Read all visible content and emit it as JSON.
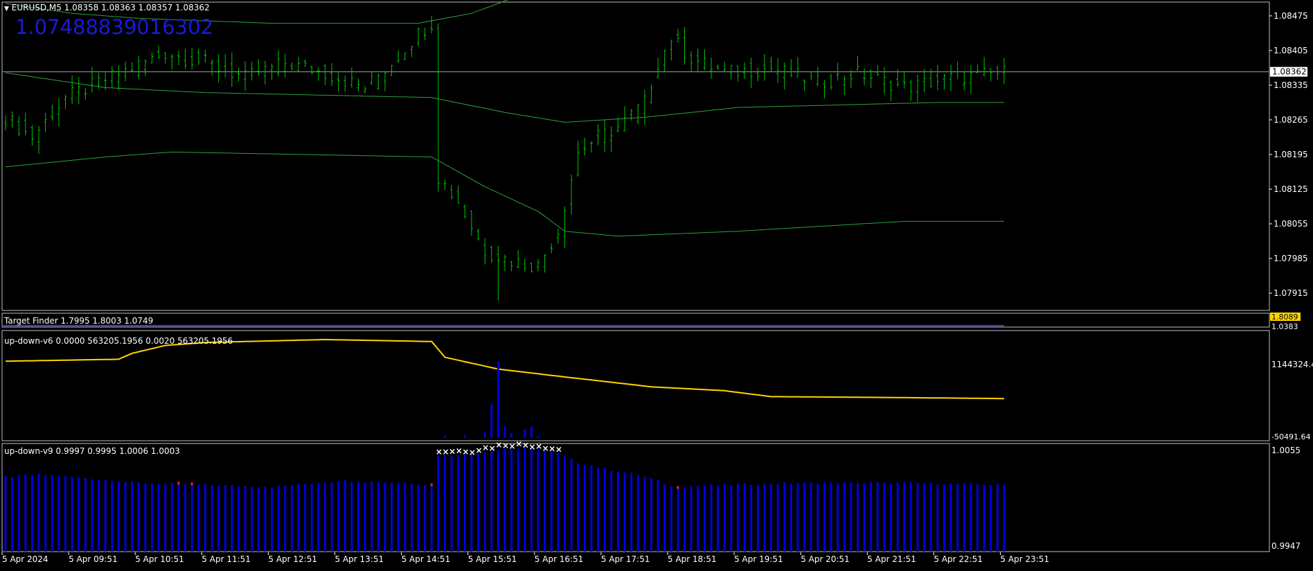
{
  "colors": {
    "background": "#000000",
    "frame": "#c0c0c0",
    "candle": "#00c800",
    "envelope": "#2ea043",
    "bid_line": "#a0a0a0",
    "price_tag_bg": "#ffffff",
    "big_value": "#1a1adb",
    "yellow_line": "#ffd700",
    "yellow_tag": "#ffd700",
    "histogram_blue": "#0000e0",
    "histogram_red": "#ff2020",
    "marker_white": "#ffffff",
    "target_line": "#3b3bd8"
  },
  "main_panel": {
    "header": "EURUSD,M5  1.08358 1.08363 1.08357 1.08362",
    "big_value": "1.07488839016302",
    "current_price_tag": "1.08362",
    "price_axis": [
      "1.08475",
      "1.08405",
      "1.08335",
      "1.08265",
      "1.08195",
      "1.08125",
      "1.08055",
      "1.07985",
      "1.07915"
    ]
  },
  "target_panel": {
    "header": "Target Finder 1.7995 1.8003 1.0749",
    "tag_yellow": "1.8089",
    "tag_white": "1.0383"
  },
  "updown6_panel": {
    "header": "up-down-v6 0.0000 563205.1956 0.0020 563205.1956",
    "axis_top": "1144324.4",
    "axis_bottom": "-50491.64"
  },
  "updown9_panel": {
    "header": "up-down-v9 0.9997 0.9995 1.0006 1.0003",
    "axis_top": "1.0055",
    "axis_bottom": "0.9947"
  },
  "time_axis": [
    "5 Apr 2024",
    "5 Apr 09:51",
    "5 Apr 10:51",
    "5 Apr 11:51",
    "5 Apr 12:51",
    "5 Apr 13:51",
    "5 Apr 14:51",
    "5 Apr 15:51",
    "5 Apr 16:51",
    "5 Apr 17:51",
    "5 Apr 18:51",
    "5 Apr 19:51",
    "5 Apr 20:51",
    "5 Apr 21:51",
    "5 Apr 22:51",
    "5 Apr 23:51"
  ],
  "chart_data": {
    "type": "candlestick",
    "symbol": "EURUSD",
    "timeframe": "M5",
    "price_ylim": [
      1.0788,
      1.085
    ],
    "close_anchors": [
      [
        0,
        1.0827
      ],
      [
        4,
        1.0823
      ],
      [
        9,
        1.0831
      ],
      [
        14,
        1.0834
      ],
      [
        19,
        1.0837
      ],
      [
        24,
        1.084
      ],
      [
        30,
        1.0838
      ],
      [
        36,
        1.0835
      ],
      [
        42,
        1.0838
      ],
      [
        48,
        1.0836
      ],
      [
        54,
        1.0833
      ],
      [
        58,
        1.0838
      ],
      [
        62,
        1.0844
      ],
      [
        64,
        1.0846
      ],
      [
        65,
        1.0815
      ],
      [
        68,
        1.081
      ],
      [
        72,
        1.08
      ],
      [
        76,
        1.0798
      ],
      [
        80,
        1.0797
      ],
      [
        83,
        1.0804
      ],
      [
        86,
        1.082
      ],
      [
        89,
        1.0823
      ],
      [
        92,
        1.0825
      ],
      [
        96,
        1.083
      ],
      [
        98,
        1.0838
      ],
      [
        100,
        1.0843
      ],
      [
        103,
        1.0839
      ],
      [
        108,
        1.0836
      ],
      [
        115,
        1.0837
      ],
      [
        122,
        1.0834
      ],
      [
        128,
        1.0836
      ],
      [
        135,
        1.0833
      ],
      [
        142,
        1.0835
      ],
      [
        150,
        1.0836
      ]
    ],
    "envelope_upper": [
      [
        0,
        1.085
      ],
      [
        10,
        1.0848
      ],
      [
        20,
        1.0847
      ],
      [
        40,
        1.0846
      ],
      [
        62,
        1.0846
      ],
      [
        70,
        1.0848
      ],
      [
        76,
        1.0851
      ]
    ],
    "envelope_middle": [
      [
        0,
        1.0836
      ],
      [
        15,
        1.0833
      ],
      [
        30,
        1.0832
      ],
      [
        64,
        1.0831
      ],
      [
        75,
        1.0828
      ],
      [
        84,
        1.0826
      ],
      [
        96,
        1.0827
      ],
      [
        110,
        1.0829
      ],
      [
        140,
        1.083
      ],
      [
        150,
        1.083
      ]
    ],
    "envelope_lower": [
      [
        0,
        1.0817
      ],
      [
        15,
        1.0819
      ],
      [
        25,
        1.082
      ],
      [
        64,
        1.0819
      ],
      [
        72,
        1.0813
      ],
      [
        80,
        1.0808
      ],
      [
        84,
        1.0804
      ],
      [
        92,
        1.0803
      ],
      [
        110,
        1.0804
      ],
      [
        135,
        1.0806
      ],
      [
        150,
        1.0806
      ]
    ],
    "yellow_line": [
      [
        0,
        0.78
      ],
      [
        17,
        0.8
      ],
      [
        19,
        0.86
      ],
      [
        24,
        0.94
      ],
      [
        30,
        0.97
      ],
      [
        48,
        1.0
      ],
      [
        64,
        0.98
      ],
      [
        66,
        0.82
      ],
      [
        74,
        0.7
      ],
      [
        84,
        0.62
      ],
      [
        97,
        0.52
      ],
      [
        108,
        0.48
      ],
      [
        115,
        0.42
      ],
      [
        135,
        0.41
      ],
      [
        150,
        0.4
      ]
    ],
    "updown6_spikes": [
      [
        66,
        0.02
      ],
      [
        69,
        0.03
      ],
      [
        72,
        0.06
      ],
      [
        73,
        0.35
      ],
      [
        74,
        0.78
      ],
      [
        75,
        0.12
      ],
      [
        76,
        0.05
      ],
      [
        78,
        0.09
      ],
      [
        79,
        0.12
      ],
      [
        80,
        0.02
      ]
    ],
    "updown9_levels": [
      [
        0,
        0.74
      ],
      [
        5,
        0.76
      ],
      [
        10,
        0.74
      ],
      [
        20,
        0.68
      ],
      [
        30,
        0.66
      ],
      [
        40,
        0.64
      ],
      [
        50,
        0.7
      ],
      [
        60,
        0.68
      ],
      [
        64,
        0.66
      ],
      [
        65,
        0.95
      ],
      [
        70,
        0.96
      ],
      [
        75,
        1.02
      ],
      [
        80,
        1.01
      ],
      [
        83,
        0.97
      ],
      [
        86,
        0.88
      ],
      [
        90,
        0.82
      ],
      [
        95,
        0.76
      ],
      [
        98,
        0.7
      ],
      [
        100,
        0.64
      ],
      [
        108,
        0.66
      ],
      [
        120,
        0.68
      ],
      [
        135,
        0.68
      ],
      [
        150,
        0.66
      ]
    ],
    "updown9_red_bars": [
      26,
      28,
      64,
      101
    ],
    "updown9_markers": [
      65,
      66,
      67,
      68,
      69,
      70,
      71,
      72,
      73,
      74,
      75,
      76,
      77,
      78,
      79,
      80,
      81,
      82,
      83
    ]
  }
}
